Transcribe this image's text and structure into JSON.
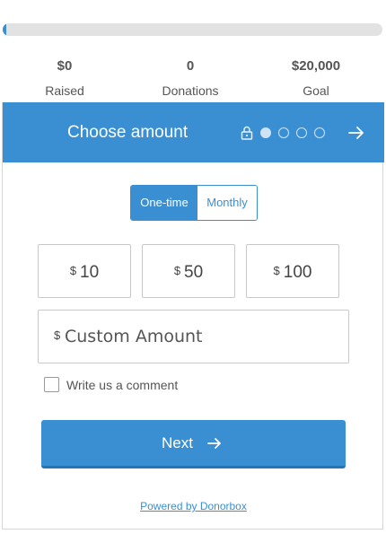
{
  "progress": {
    "fraction": 0.01,
    "color": "#3a8fd3",
    "track_color": "#e2e2e2"
  },
  "stats": {
    "raised": {
      "value": "$0",
      "label": "Raised"
    },
    "donations": {
      "value": "0",
      "label": "Donations"
    },
    "goal": {
      "value": "$20,000",
      "label": "Goal"
    }
  },
  "header": {
    "title": "Choose amount",
    "lock_icon": "lock-icon",
    "steps_total": 4,
    "step_current": 1,
    "next_icon": "arrow-right-icon"
  },
  "frequency": {
    "options": [
      "One-time",
      "Monthly"
    ],
    "selected": "One-time"
  },
  "amounts": [
    {
      "currency": "$",
      "value": "10"
    },
    {
      "currency": "$",
      "value": "50"
    },
    {
      "currency": "$",
      "value": "100"
    }
  ],
  "custom": {
    "currency": "$",
    "placeholder": "Custom Amount",
    "value": ""
  },
  "comment": {
    "label": "Write us a comment",
    "checked": false
  },
  "next_button": {
    "label": "Next",
    "icon": "arrow-right-icon"
  },
  "footer": {
    "powered_by": "Powered by Donorbox"
  },
  "colors": {
    "accent": "#3a8fd3",
    "accent_dark": "#2774b5",
    "border": "#c8c8c8"
  }
}
